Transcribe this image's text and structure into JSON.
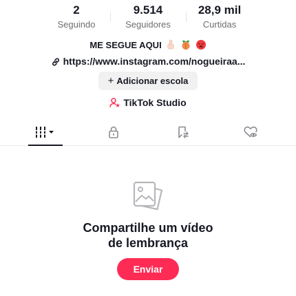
{
  "stats": {
    "following": {
      "value": "2",
      "label": "Seguindo"
    },
    "followers": {
      "value": "9.514",
      "label": "Seguidores"
    },
    "likes": {
      "value": "28,9 mil",
      "label": "Curtidas"
    }
  },
  "bio": {
    "text": "ME SEGUE AQUI",
    "emojis": [
      "pointing-down-emoji",
      "peach-emoji",
      "hot-face-emoji"
    ]
  },
  "link": {
    "text": "https://www.instagram.com/nogueiraa..."
  },
  "school_button": {
    "plus": "+",
    "label": "Adicionar escola"
  },
  "studio": {
    "label": "TikTok Studio",
    "accent": "#fe2c55"
  },
  "tabs": [
    {
      "name": "videos-tab",
      "icon": "grid-filter-icon",
      "active": true
    },
    {
      "name": "private-tab",
      "icon": "lock-icon",
      "active": false
    },
    {
      "name": "reposts-tab",
      "icon": "repost-bookmark-icon",
      "active": false
    },
    {
      "name": "liked-tab",
      "icon": "heart-eye-icon",
      "active": false
    }
  ],
  "empty_state": {
    "icon": "photo-stack-icon",
    "title_line1": "Compartilhe um vídeo",
    "title_line2": "de lembrança",
    "button_label": "Enviar"
  },
  "colors": {
    "primary": "#fe2c55",
    "text": "#161823",
    "muted": "#6e6e73"
  }
}
